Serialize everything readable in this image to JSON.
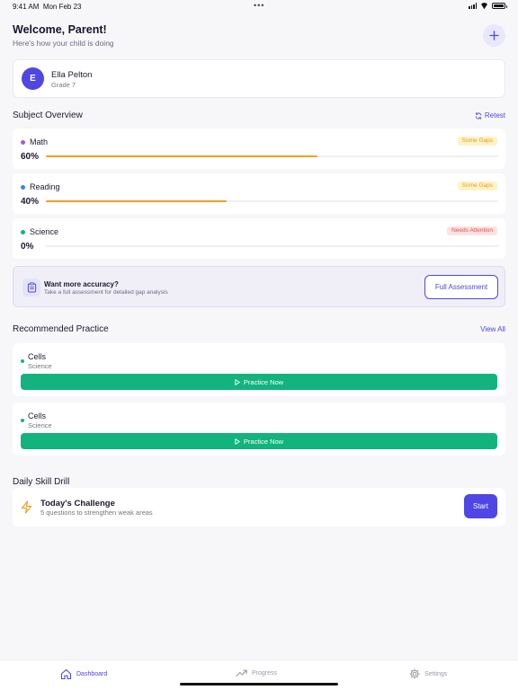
{
  "status_bar": {
    "time": "9:41 AM",
    "date": "Mon Feb 23",
    "dots": "•••"
  },
  "header": {
    "title": "Welcome, Parent!",
    "subtitle": "Here's how your child is doing",
    "add_symbol": "+"
  },
  "student": {
    "initial": "E",
    "name": "Ella Pelton",
    "grade": "Grade 7"
  },
  "subject_overview": {
    "title": "Subject Overview",
    "retest_label": "Retest",
    "subjects": [
      {
        "name": "Math",
        "percent_label": "60%",
        "progress": 0.6,
        "dot_color": "#9b5de5",
        "badge": "Some Gaps",
        "badge_bg": "#fef3c7",
        "badge_color": "#e0a020"
      },
      {
        "name": "Reading",
        "percent_label": "40%",
        "progress": 0.4,
        "dot_color": "#3b82f6",
        "badge": "Some Gaps",
        "badge_bg": "#fef3c7",
        "badge_color": "#e0a020"
      },
      {
        "name": "Science",
        "percent_label": "0%",
        "progress": 0.0,
        "dot_color": "#10b77f",
        "badge": "Needs Attention",
        "badge_bg": "#fde2e2",
        "badge_color": "#e05252"
      }
    ]
  },
  "accuracy": {
    "title": "Want more accuracy?",
    "subtitle": "Take a full assessment for detailed gap analysis",
    "button_label": "Full Assessment"
  },
  "recommended": {
    "title": "Recommended Practice",
    "view_all_label": "View All",
    "items": [
      {
        "name": "Cells",
        "subject": "Science",
        "button_label": "Practice Now"
      },
      {
        "name": "Cells",
        "subject": "Science",
        "button_label": "Practice Now"
      }
    ]
  },
  "daily_drill": {
    "title": "Daily Skill Drill",
    "challenge_title": "Today's Challenge",
    "challenge_subtitle": "5 questions to strengthen weak areas",
    "start_label": "Start"
  },
  "tabs": [
    {
      "label": "Dashboard",
      "icon": "home-icon",
      "active": true
    },
    {
      "label": "Progress",
      "icon": "trending-up-icon",
      "active": false
    },
    {
      "label": "Settings",
      "icon": "gear-icon",
      "active": false
    }
  ],
  "colors": {
    "accent": "#4f46e5",
    "success": "#13b37d",
    "progress_fill": "#f0a020",
    "background": "#f7f7fa"
  }
}
